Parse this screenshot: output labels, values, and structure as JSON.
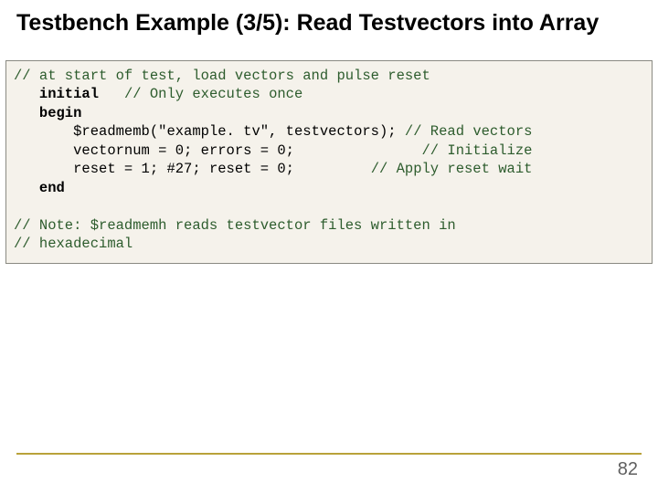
{
  "title": "Testbench Example (3/5): Read Testvectors into Array",
  "code": {
    "c1": "// at start of test, load vectors and pulse reset",
    "kw_initial": "initial",
    "c2": "// Only executes once",
    "kw_begin": "begin",
    "stmt_read": "$readmemb(\"example. tv\", testvectors);",
    "c3": "// Read vectors",
    "stmt_init": "vectornum = 0; errors = 0;",
    "c4": "// Initialize",
    "stmt_reset": "reset = 1; #27; reset = 0;",
    "c5": "// Apply reset wait",
    "kw_end": "end",
    "note1": "// Note: $readmemh reads testvector files written in",
    "note2": "// hexadecimal"
  },
  "page_number": "82"
}
